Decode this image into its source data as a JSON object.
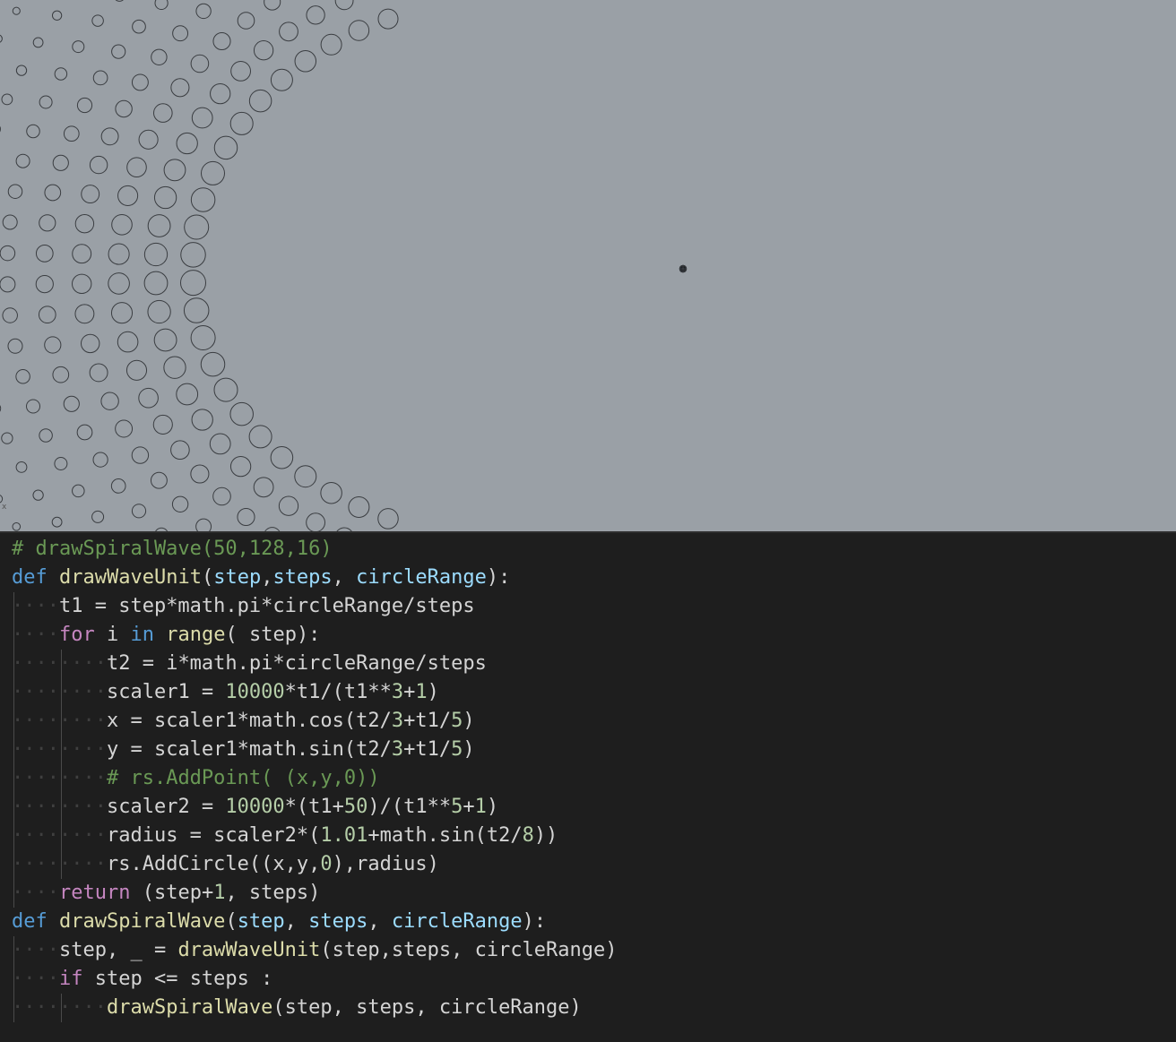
{
  "viewport": {
    "axis_marker": "x",
    "background": "#9aa0a6",
    "stroke": "#3a3d41",
    "spiral_params": {
      "start_step": 50,
      "steps": 128,
      "circle_range": 16
    }
  },
  "editor": {
    "colors": {
      "comment": "#6a9955",
      "keyword": "#569cd6",
      "control": "#c586c0",
      "function": "#dcdcaa",
      "parameter": "#9cdcfe",
      "number": "#b5cea8",
      "text": "#d4d4d4"
    },
    "lines": [
      {
        "indent": 0,
        "tokens": [
          [
            "comment",
            "# drawSpiralWave(50,128,16)"
          ]
        ]
      },
      {
        "indent": 0,
        "tokens": [
          [
            "keyword",
            "def"
          ],
          [
            "text",
            " "
          ],
          [
            "function",
            "drawWaveUnit"
          ],
          [
            "text",
            "("
          ],
          [
            "param",
            "step"
          ],
          [
            "text",
            ","
          ],
          [
            "param",
            "steps"
          ],
          [
            "text",
            ", "
          ],
          [
            "param",
            "circleRange"
          ],
          [
            "text",
            "):"
          ]
        ]
      },
      {
        "indent": 1,
        "tokens": [
          [
            "text",
            "t1 = step*math.pi*circleRange/steps"
          ]
        ]
      },
      {
        "indent": 1,
        "tokens": [
          [
            "control",
            "for"
          ],
          [
            "text",
            " i "
          ],
          [
            "keyword",
            "in"
          ],
          [
            "text",
            " "
          ],
          [
            "function",
            "range"
          ],
          [
            "text",
            "( step):"
          ]
        ]
      },
      {
        "indent": 2,
        "tokens": [
          [
            "text",
            "t2 = i*math.pi*circleRange/steps"
          ]
        ]
      },
      {
        "indent": 2,
        "tokens": [
          [
            "text",
            "scaler1 = "
          ],
          [
            "number",
            "10000"
          ],
          [
            "text",
            "*t1/(t1**"
          ],
          [
            "number",
            "3"
          ],
          [
            "text",
            "+"
          ],
          [
            "number",
            "1"
          ],
          [
            "text",
            ")"
          ]
        ]
      },
      {
        "indent": 2,
        "tokens": [
          [
            "text",
            "x = scaler1*math.cos(t2/"
          ],
          [
            "number",
            "3"
          ],
          [
            "text",
            "+t1/"
          ],
          [
            "number",
            "5"
          ],
          [
            "text",
            ")"
          ]
        ]
      },
      {
        "indent": 2,
        "tokens": [
          [
            "text",
            "y = scaler1*math.sin(t2/"
          ],
          [
            "number",
            "3"
          ],
          [
            "text",
            "+t1/"
          ],
          [
            "number",
            "5"
          ],
          [
            "text",
            ")"
          ]
        ]
      },
      {
        "indent": 2,
        "tokens": [
          [
            "comment",
            "# rs.AddPoint( (x,y,0))"
          ]
        ]
      },
      {
        "indent": 2,
        "tokens": [
          [
            "text",
            "scaler2 = "
          ],
          [
            "number",
            "10000"
          ],
          [
            "text",
            "*(t1+"
          ],
          [
            "number",
            "50"
          ],
          [
            "text",
            ")/(t1**"
          ],
          [
            "number",
            "5"
          ],
          [
            "text",
            "+"
          ],
          [
            "number",
            "1"
          ],
          [
            "text",
            ")"
          ]
        ]
      },
      {
        "indent": 2,
        "tokens": [
          [
            "text",
            "radius = scaler2*("
          ],
          [
            "number",
            "1.01"
          ],
          [
            "text",
            "+math.sin(t2/"
          ],
          [
            "number",
            "8"
          ],
          [
            "text",
            "))"
          ]
        ]
      },
      {
        "indent": 2,
        "tokens": [
          [
            "text",
            "rs.AddCircle((x,y,"
          ],
          [
            "number",
            "0"
          ],
          [
            "text",
            "),radius)"
          ]
        ]
      },
      {
        "indent": 1,
        "tokens": [
          [
            "control",
            "return"
          ],
          [
            "text",
            " (step+"
          ],
          [
            "number",
            "1"
          ],
          [
            "text",
            ", steps)"
          ]
        ]
      },
      {
        "indent": 0,
        "tokens": [
          [
            "keyword",
            "def"
          ],
          [
            "text",
            " "
          ],
          [
            "function",
            "drawSpiralWave"
          ],
          [
            "text",
            "("
          ],
          [
            "param",
            "step"
          ],
          [
            "text",
            ", "
          ],
          [
            "param",
            "steps"
          ],
          [
            "text",
            ", "
          ],
          [
            "param",
            "circleRange"
          ],
          [
            "text",
            "):"
          ]
        ]
      },
      {
        "indent": 1,
        "tokens": [
          [
            "text",
            "step, _ = "
          ],
          [
            "function",
            "drawWaveUnit"
          ],
          [
            "text",
            "(step,steps, circleRange)"
          ]
        ]
      },
      {
        "indent": 1,
        "tokens": [
          [
            "control",
            "if"
          ],
          [
            "text",
            " step <= steps :"
          ]
        ]
      },
      {
        "indent": 2,
        "tokens": [
          [
            "function",
            "drawSpiralWave"
          ],
          [
            "text",
            "(step, steps, circleRange)"
          ]
        ]
      }
    ]
  }
}
